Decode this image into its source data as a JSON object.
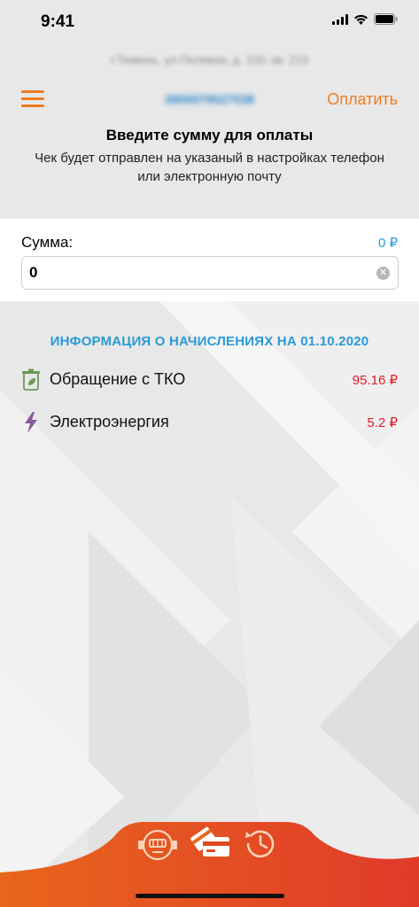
{
  "status_bar": {
    "time": "9:41"
  },
  "header": {
    "address": "г.Тюмень, ул.Полевая, д. 100, кв. 213",
    "account_number": "3900079527538",
    "pay_label": "Оплатить",
    "title": "Введите сумму для оплаты",
    "subtitle": "Чек будет отправлен на указаный в настройках телефон или электронную почту"
  },
  "amount": {
    "label": "Сумма:",
    "total": "0 ₽",
    "input_value": "0"
  },
  "charges": {
    "title": "ИНФОРМАЦИЯ О НАЧИСЛЕНИЯХ НА 01.10.2020",
    "items": [
      {
        "name": "Обращение с ТКО",
        "amount": "95.16 ₽",
        "icon": "waste-bin-icon"
      },
      {
        "name": "Электроэнергия",
        "amount": "5.2 ₽",
        "icon": "lightning-icon"
      }
    ]
  },
  "tab_bar": {
    "tabs": [
      {
        "icon": "meter-icon"
      },
      {
        "icon": "payment-card-icon"
      },
      {
        "icon": "history-icon"
      }
    ]
  },
  "colors": {
    "accent_orange": "#f07b1e",
    "info_blue": "#2a9ad6",
    "amount_red": "#e31a24",
    "tab_gradient_start": "#e8601c",
    "tab_gradient_end": "#e03a2a"
  }
}
